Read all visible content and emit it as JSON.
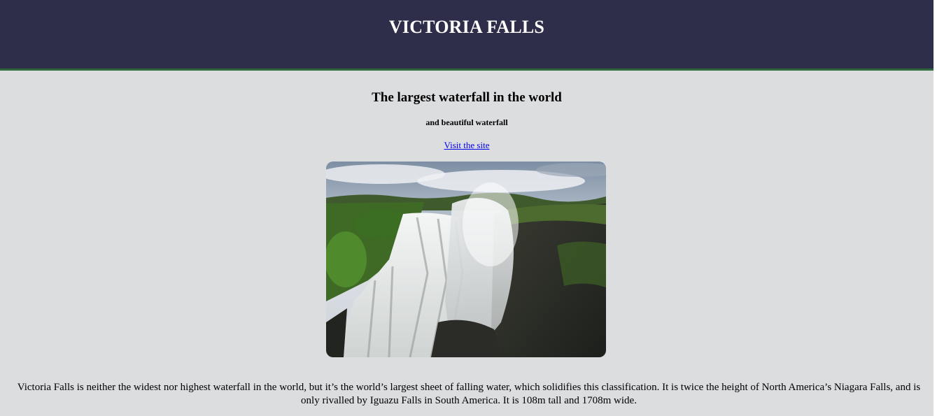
{
  "header": {
    "title": "VICTORIA FALLS"
  },
  "main": {
    "heading": "The largest waterfall in the world",
    "tagline": "and beautiful waterfall",
    "link_label": "Visit the site",
    "image_alt": "Victoria Falls waterfall photo",
    "description": "Victoria Falls is neither the widest nor highest waterfall in the world, but it’s the world’s largest sheet of falling water, which solidifies this classification. It is twice the height of North America’s Niagara Falls, and is only rivalled by Iguazu Falls in South America. It is 108m tall and 1708m wide."
  },
  "colors": {
    "header_bg": "#2f2e4a",
    "header_border": "#2f6b3a",
    "page_bg": "#dcdddf",
    "link": "#0000ee"
  }
}
